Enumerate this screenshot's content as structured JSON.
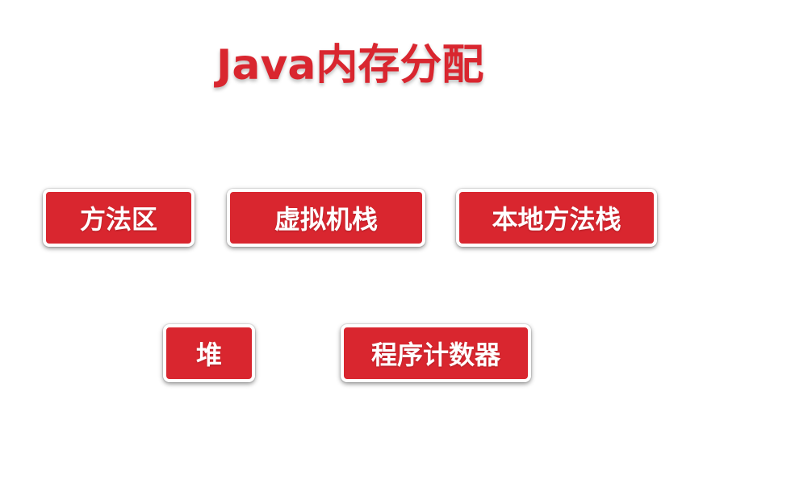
{
  "title": "Java内存分配",
  "areas": [
    {
      "label": "方法区"
    },
    {
      "label": "虚拟机栈"
    },
    {
      "label": "本地方法栈"
    },
    {
      "label": "堆"
    },
    {
      "label": "程序计数器"
    }
  ],
  "colors": {
    "accent": "#d9262f",
    "box_border": "#ffffff",
    "background": "#ffffff"
  }
}
